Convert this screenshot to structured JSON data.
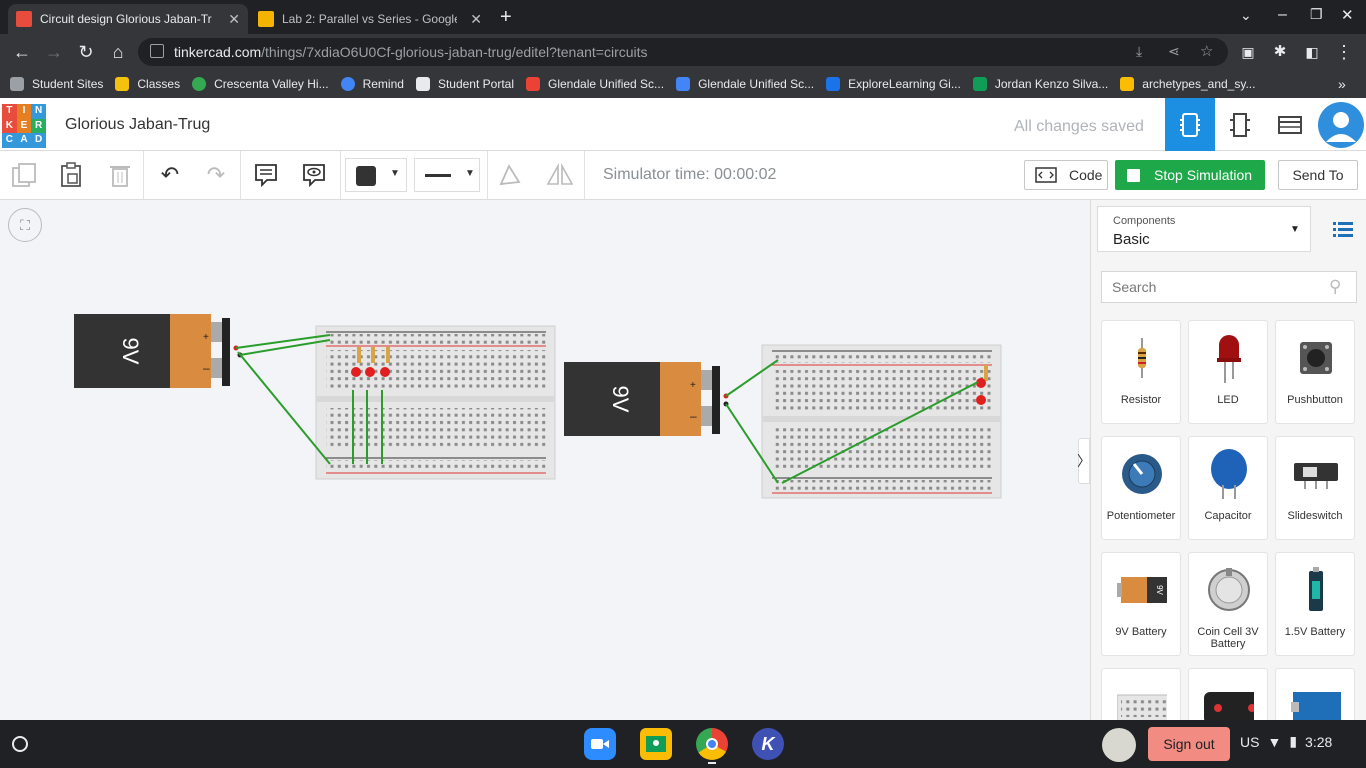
{
  "browser": {
    "tabs": [
      {
        "title": "Circuit design Glorious Jaban-Tr",
        "active": true
      },
      {
        "title": "Lab 2: Parallel vs Series - Google",
        "active": false
      }
    ],
    "url_domain": "tinkercad.com",
    "url_path": "/things/7xdiaO6U0Cf-glorious-jaban-trug/editel?tenant=circuits",
    "bookmarks": [
      {
        "label": "Student Sites",
        "color": "#9aa0a6"
      },
      {
        "label": "Classes",
        "color": "#f4c20d"
      },
      {
        "label": "Crescenta Valley Hi...",
        "color": "#34a853"
      },
      {
        "label": "Remind",
        "color": "#4285f4"
      },
      {
        "label": "Student Portal",
        "color": "#e8eaed"
      },
      {
        "label": "Glendale Unified Sc...",
        "color": "#ea4335"
      },
      {
        "label": "Glendale Unified Sc...",
        "color": "#4285f4"
      },
      {
        "label": "ExploreLearning Gi...",
        "color": "#1a73e8"
      },
      {
        "label": "Jordan Kenzo Silva...",
        "color": "#0f9d58"
      },
      {
        "label": "archetypes_and_sy...",
        "color": "#fbbc04"
      }
    ]
  },
  "app": {
    "logo_letters": [
      "T",
      "I",
      "N",
      "K",
      "E",
      "R",
      "C",
      "A",
      "D"
    ],
    "logo_colors": [
      "#e74c3c",
      "#e67e22",
      "#3498db",
      "#e74c3c",
      "#e67e22",
      "#27ae60",
      "#3498db",
      "#3498db",
      "#3498db"
    ],
    "project_title": "Glorious Jaban-Trug",
    "save_status": "All changes saved",
    "accent": "#1d8fe2"
  },
  "toolbar": {
    "simulator_time": "Simulator time: 00:00:02",
    "code_label": "Code",
    "stop_label": "Stop Simulation",
    "sendto_label": "Send To"
  },
  "canvas": {
    "battery_label": "9V"
  },
  "panel": {
    "components_label": "Components",
    "components_value": "Basic",
    "search_placeholder": "Search",
    "items": [
      {
        "name": "Resistor",
        "icon": "resistor-icon"
      },
      {
        "name": "LED",
        "icon": "led-icon"
      },
      {
        "name": "Pushbutton",
        "icon": "pushbutton-icon"
      },
      {
        "name": "Potentiometer",
        "icon": "potentiometer-icon"
      },
      {
        "name": "Capacitor",
        "icon": "capacitor-icon"
      },
      {
        "name": "Slideswitch",
        "icon": "slideswitch-icon"
      },
      {
        "name": "9V Battery",
        "icon": "battery-9v-icon"
      },
      {
        "name": "Coin Cell 3V Battery",
        "icon": "coin-cell-icon"
      },
      {
        "name": "1.5V Battery",
        "icon": "battery-15v-icon"
      }
    ]
  },
  "shelf": {
    "signout_label": "Sign out",
    "locale": "US",
    "time": "3:28"
  }
}
